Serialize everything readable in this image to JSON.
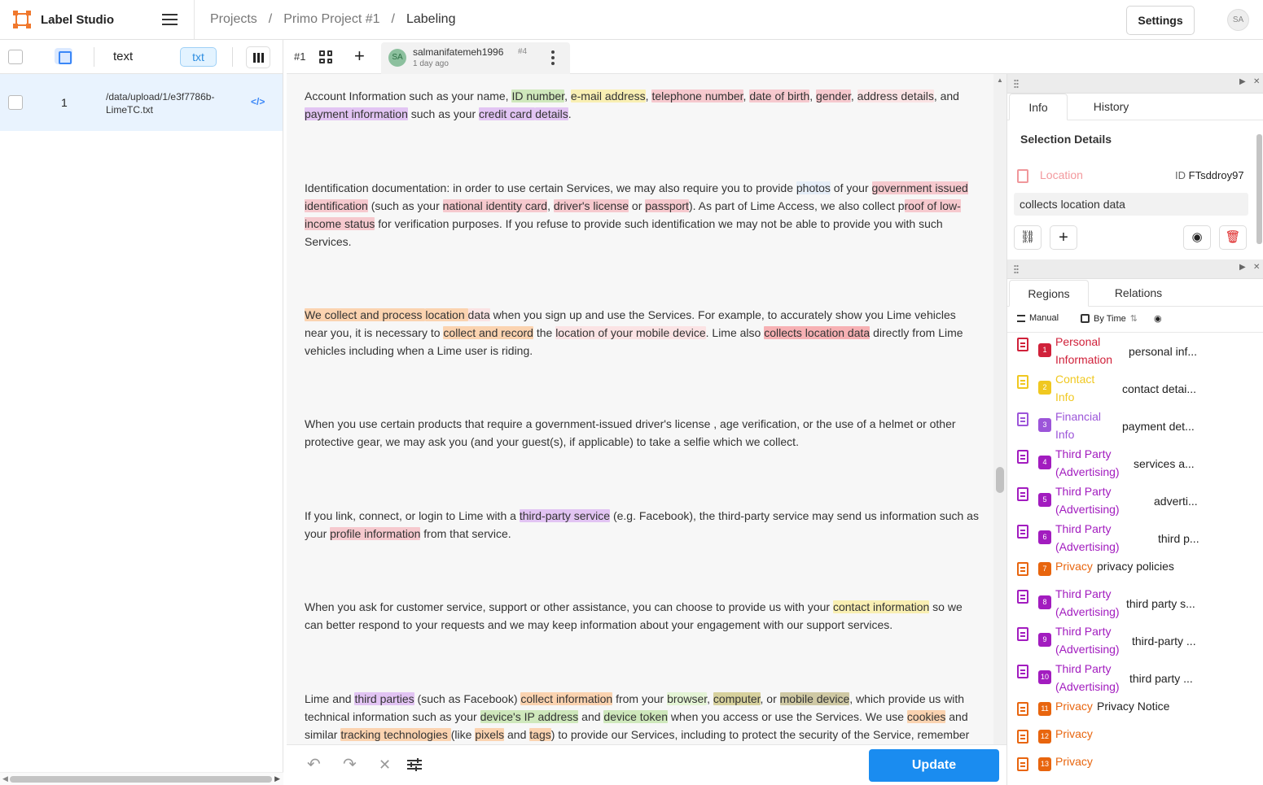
{
  "app": {
    "title": "Label Studio",
    "breadcrumb": [
      "Projects",
      "Primo Project #1",
      "Labeling"
    ],
    "settings_label": "Settings",
    "user_initials": "SA"
  },
  "left": {
    "columns": {
      "text": "text",
      "type_badge": "txt"
    },
    "rows": [
      {
        "id": "1",
        "path": "/data/upload/1/e3f7786b-LimeTC.txt",
        "code_icon": "</>"
      }
    ]
  },
  "annotation": {
    "number": "#1",
    "user": "salmanifatemeh1996",
    "id": "#4",
    "time": "1 day ago",
    "initials": "SA"
  },
  "main": {
    "paragraphs": [
      [
        {
          "t": "Account Information such as your name, "
        },
        {
          "t": "ID number",
          "c": "c-id"
        },
        {
          "t": ", "
        },
        {
          "t": "e-mail address",
          "c": "c-contact"
        },
        {
          "t": ", "
        },
        {
          "t": "telephone number",
          "c": "c-personal"
        },
        {
          "t": ", "
        },
        {
          "t": "date of birth",
          "c": "c-personal"
        },
        {
          "t": ", "
        },
        {
          "t": "gender",
          "c": "c-personal"
        },
        {
          "t": ", "
        },
        {
          "t": "address details",
          "c": "c-lpink"
        },
        {
          "t": ", and "
        },
        {
          "t": "payment ",
          "c": "c-purple"
        },
        {
          "t": "information",
          "c": "c-purple"
        },
        {
          "t": " such as your "
        },
        {
          "t": "credit card ",
          "c": "c-purple"
        },
        {
          "t": "details",
          "c": "c-purple"
        },
        {
          "t": "."
        }
      ],
      [
        {
          "t": "Identification documentation: in order to use certain Services, we may also require you to provide "
        },
        {
          "t": "photos",
          "c": "c-blue"
        },
        {
          "t": " of your "
        },
        {
          "t": "government issued identification",
          "c": "c-personal"
        },
        {
          "t": " (such as your "
        },
        {
          "t": "national identity card",
          "c": "c-personal"
        },
        {
          "t": ", "
        },
        {
          "t": "driver's license",
          "c": "c-personal"
        },
        {
          "t": " or "
        },
        {
          "t": "passport",
          "c": "c-personal"
        },
        {
          "t": "). As part of Lime Access, we also collect p"
        },
        {
          "t": "roof of low-income status",
          "c": "c-personal"
        },
        {
          "t": " for verification purposes. If you refuse to provide such identification we may not be able to provide you with such Services."
        }
      ],
      [
        {
          "t": "We collect and process ",
          "c": "c-orange"
        },
        {
          "t": " "
        },
        {
          "t": "location ",
          "c": "c-orange"
        },
        {
          "t": "data",
          "c": "c-lpink"
        },
        {
          "t": " when you sign up and use the Services. For example, to accurately show you Lime vehicles near you, it is necessary to "
        },
        {
          "t": "collect and record",
          "c": "c-orange"
        },
        {
          "t": " the "
        },
        {
          "t": "location of your mobile device",
          "c": "c-lpink"
        },
        {
          "t": ". Lime also "
        },
        {
          "t": "collects location data",
          "c": "c-loc"
        },
        {
          "t": " directly from Lime vehicles including when a Lime user is riding."
        }
      ],
      [
        {
          "t": "When you use certain products that require a government-issued driver's license , age verification, or the use of a helmet or other protective gear, we may ask you (and your guest(s), if applicable) to take a selfie which we collect."
        }
      ],
      [
        {
          "t": "If you link, connect, or login to Lime with a "
        },
        {
          "t": "third-party service",
          "c": "c-purple"
        },
        {
          "t": " (e.g. Facebook), the third-party service may send us information such as your "
        },
        {
          "t": "profile information",
          "c": "c-personal"
        },
        {
          "t": " from that service."
        }
      ],
      [
        {
          "t": "When you ask for customer service, support or other assistance, you can choose to provide us with your "
        },
        {
          "t": "contact information",
          "c": "c-contact"
        },
        {
          "t": " so we can better respond to your requests and we may keep information about your engagement with our support services."
        }
      ],
      [
        {
          "t": "Lime and "
        },
        {
          "t": "third parties",
          "c": "c-purple"
        },
        {
          "t": " (such as Facebook) "
        },
        {
          "t": "collect information",
          "c": "c-orange"
        },
        {
          "t": " from your "
        },
        {
          "t": "browser",
          "c": "c-lightgreen"
        },
        {
          "t": ", "
        },
        {
          "t": "computer",
          "c": "c-olive"
        },
        {
          "t": ", or "
        },
        {
          "t": "mobile device",
          "c": "c-olive2"
        },
        {
          "t": ", which provide us with technical information such as your "
        },
        {
          "t": "device's IP address",
          "c": "c-id"
        },
        {
          "t": " and "
        },
        {
          "t": "device token",
          "c": "c-id"
        },
        {
          "t": " when you access or use the Services. We use "
        },
        {
          "t": "cookies",
          "c": "c-orange"
        },
        {
          "t": " and similar "
        },
        {
          "t": "tracking technologies ",
          "c": "c-orange"
        },
        {
          "t": "(like "
        },
        {
          "t": "pixels",
          "c": "c-orange"
        },
        {
          "t": " and "
        },
        {
          "t": "tags",
          "c": "c-orange"
        },
        {
          "t": ") to provide our Services, including to protect the security of the Service, remember"
        }
      ]
    ]
  },
  "bottom": {
    "update_label": "Update"
  },
  "info_panel": {
    "tabs": [
      "Info",
      "History"
    ],
    "title": "Selection Details",
    "label": "Location",
    "id_prefix": "ID",
    "id_value": "FTsddroy97",
    "text": "collects location data",
    "colors": {
      "location": "#f3999d"
    }
  },
  "regions_panel": {
    "tabs": [
      "Regions",
      "Relations"
    ],
    "filters": [
      "Manual",
      "By Time"
    ],
    "colors": {
      "personal": "#d0213a",
      "contact": "#f0c820",
      "financial": "#9c55d9",
      "thirdparty": "#a21cbf",
      "privacy": "#e8650e"
    },
    "items": [
      {
        "n": "1",
        "label": "Personal Information",
        "text": "personal inf...",
        "color": "#d0213a"
      },
      {
        "n": "2",
        "label": "Contact Info",
        "text": "contact detai...",
        "color": "#f0c820"
      },
      {
        "n": "3",
        "label": "Financial Info",
        "text": "payment det...",
        "color": "#9c55d9"
      },
      {
        "n": "4",
        "label": "Third Party (Advertising)",
        "text": "services a...",
        "color": "#a21cbf"
      },
      {
        "n": "5",
        "label": "Third Party (Advertising)",
        "text": "adverti...",
        "color": "#a21cbf"
      },
      {
        "n": "6",
        "label": "Third Party (Advertising)",
        "text": "third p...",
        "color": "#a21cbf"
      },
      {
        "n": "7",
        "label": "Privacy",
        "text": "privacy policies",
        "color": "#e8650e"
      },
      {
        "n": "8",
        "label": "Third Party (Advertising)",
        "text": "third party s...",
        "color": "#a21cbf"
      },
      {
        "n": "9",
        "label": "Third Party (Advertising)",
        "text": "third-party ...",
        "color": "#a21cbf"
      },
      {
        "n": "10",
        "label": "Third Party (Advertising)",
        "text": "third party ...",
        "color": "#a21cbf"
      },
      {
        "n": "11",
        "label": "Privacy",
        "text": "Privacy Notice",
        "color": "#e8650e"
      },
      {
        "n": "12",
        "label": "Privacy",
        "text": "",
        "color": "#e8650e"
      },
      {
        "n": "13",
        "label": "Privacy",
        "text": "",
        "color": "#e8650e"
      }
    ]
  }
}
